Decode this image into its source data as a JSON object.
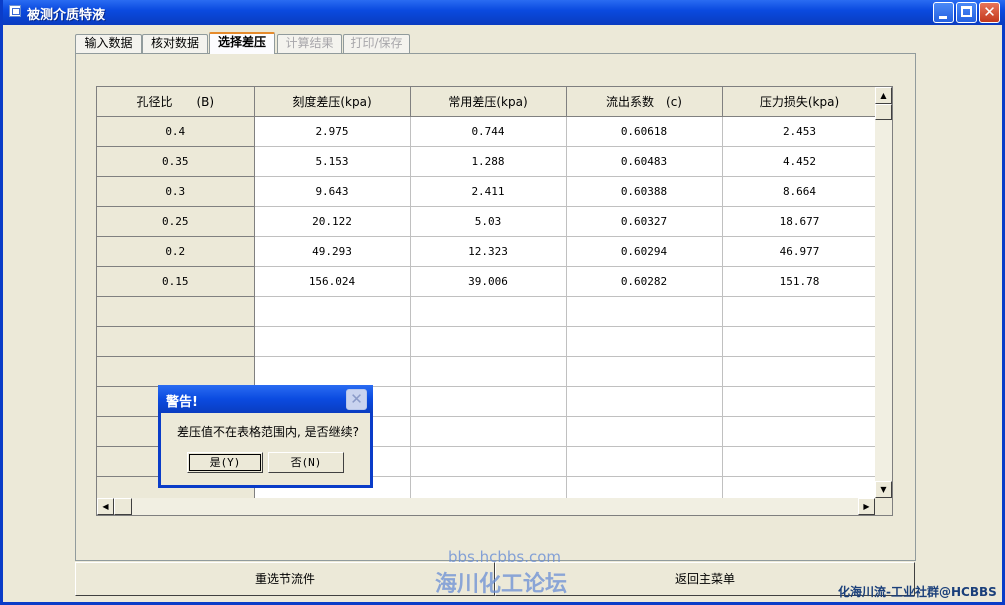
{
  "window": {
    "title": "被测介质特液"
  },
  "tabs": [
    {
      "label": "输入数据",
      "state": "normal"
    },
    {
      "label": "核对数据",
      "state": "normal"
    },
    {
      "label": "选择差压",
      "state": "active"
    },
    {
      "label": "计算结果",
      "state": "disabled"
    },
    {
      "label": "打印/保存",
      "state": "disabled"
    }
  ],
  "table": {
    "headers": [
      "孔径比　　(B)",
      "刻度差压(kpa)",
      "常用差压(kpa)",
      "流出系数　(c)",
      "压力损失(kpa)"
    ],
    "rows": [
      [
        "0.4",
        "2.975",
        "0.744",
        "0.60618",
        "2.453"
      ],
      [
        "0.35",
        "5.153",
        "1.288",
        "0.60483",
        "4.452"
      ],
      [
        "0.3",
        "9.643",
        "2.411",
        "0.60388",
        "8.664"
      ],
      [
        "0.25",
        "20.122",
        "5.03",
        "0.60327",
        "18.677"
      ],
      [
        "0.2",
        "49.293",
        "12.323",
        "0.60294",
        "46.977"
      ],
      [
        "0.15",
        "156.024",
        "39.006",
        "0.60282",
        "151.78"
      ]
    ]
  },
  "buttons": {
    "reselect": "重选节流件",
    "return_menu": "返回主菜单"
  },
  "dialog": {
    "title": "警告!",
    "message": "差压值不在表格范围内, 是否继续?",
    "yes": "是(Y)",
    "no": "否(N)"
  },
  "watermark": {
    "url": "bbs.hcbbs.com",
    "name": "海川化工论坛",
    "corner": "化海川流-工业社群@HCBBS"
  }
}
